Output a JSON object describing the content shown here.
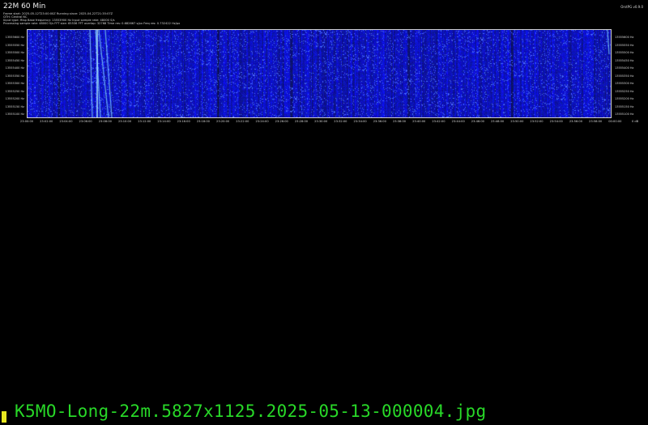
{
  "header": {
    "title": "22M 60 Min",
    "version": "OrstPG v0.9.0",
    "info_lines": [
      "Frame start: 2025-05-12T23:00:00Z   Running since: 2025-04-22T21:35:07Z",
      "QTH: Central NC",
      "Input type: Rtsp  Base frequency: 13553900 Hz  Input sample rate: 48000 S/s",
      "Processing sample rate: 48000 S/s  FFT size: 65536  FFT overlap: 32768  Time res: 0.682667 s/px  Freq res: 0.732422 Hz/px"
    ]
  },
  "y_axis_left": [
    "13555600 Hz",
    "13555550 Hz",
    "13555500 Hz",
    "13555450 Hz",
    "13555400 Hz",
    "13555350 Hz",
    "13555300 Hz",
    "13555250 Hz",
    "13555200 Hz",
    "13555150 Hz",
    "13555100 Hz"
  ],
  "y_axis_right": [
    "13555600 Hz",
    "13555550 Hz",
    "13555500 Hz",
    "13555450 Hz",
    "13555400 Hz",
    "13555350 Hz",
    "13555300 Hz",
    "13555250 Hz",
    "13555200 Hz",
    "13555150 Hz",
    "13555100 Hz"
  ],
  "x_axis": [
    "23:00:00",
    "23:02:00",
    "23:04:00",
    "23:06:00",
    "23:08:00",
    "23:10:00",
    "23:12:00",
    "23:14:00",
    "23:16:00",
    "23:18:00",
    "23:20:00",
    "23:22:00",
    "23:24:00",
    "23:26:00",
    "23:28:00",
    "23:30:00",
    "23:32:00",
    "23:34:00",
    "23:36:00",
    "23:38:00",
    "23:40:00",
    "23:42:00",
    "23:44:00",
    "23:46:00",
    "23:48:00",
    "23:50:00",
    "23:52:00",
    "23:54:00",
    "23:56:00",
    "23:58:00",
    "00:00:00"
  ],
  "x_axis_extra": "0 dB",
  "terminal_text": "K5MO-Long-22m.5827x1125.2025-05-13-000004.jpg",
  "colors": {
    "background": "#000000",
    "waterfall_base": "#0a10a8",
    "signal": "#7fc8ff",
    "terminal_text": "#28d828",
    "cursor": "#e8e820"
  }
}
